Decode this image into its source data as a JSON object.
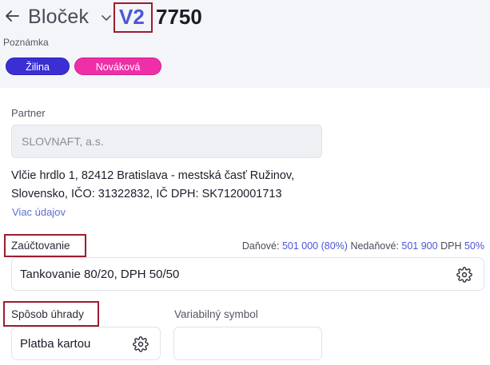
{
  "header": {
    "back_icon": "arrow-left-icon",
    "doc_type": "Bloček",
    "chevron_icon": "chevron-down-icon",
    "version": "V2",
    "doc_number": "7750",
    "note_label": "Poznámka",
    "tags": [
      {
        "label": "Žilina",
        "color": "#3b2fd4"
      },
      {
        "label": "Nováková",
        "color": "#ef2fa7"
      }
    ]
  },
  "partner": {
    "label": "Partner",
    "value": "SLOVNAFT, a.s.",
    "address_line1": "Vlčie hrdlo 1, 82412 Bratislava - mestská časť Ružinov,",
    "address_line2": "Slovensko, IČO: 31322832, IČ DPH: SK7120001713",
    "more_link": "Viac údajov"
  },
  "accounting": {
    "label": "Zaúčtovanie",
    "summary": {
      "tax_label": "Daňové:",
      "tax_value": "501 000 (80%)",
      "nontax_label": "Nedaňové:",
      "nontax_value": "501 900",
      "vat_label": "DPH",
      "vat_value": "50%"
    },
    "value": "Tankovanie 80/20, DPH 50/50",
    "settings_icon": "gear-icon"
  },
  "payment": {
    "label": "Spôsob úhrady",
    "value": "Platba kartou",
    "settings_icon": "gear-icon"
  },
  "variable_symbol": {
    "label": "Variabilný symbol",
    "value": ""
  },
  "colors": {
    "accent": "#4b57d6",
    "highlight_border": "#9b1c31",
    "header_bg": "#f4f5f9"
  }
}
